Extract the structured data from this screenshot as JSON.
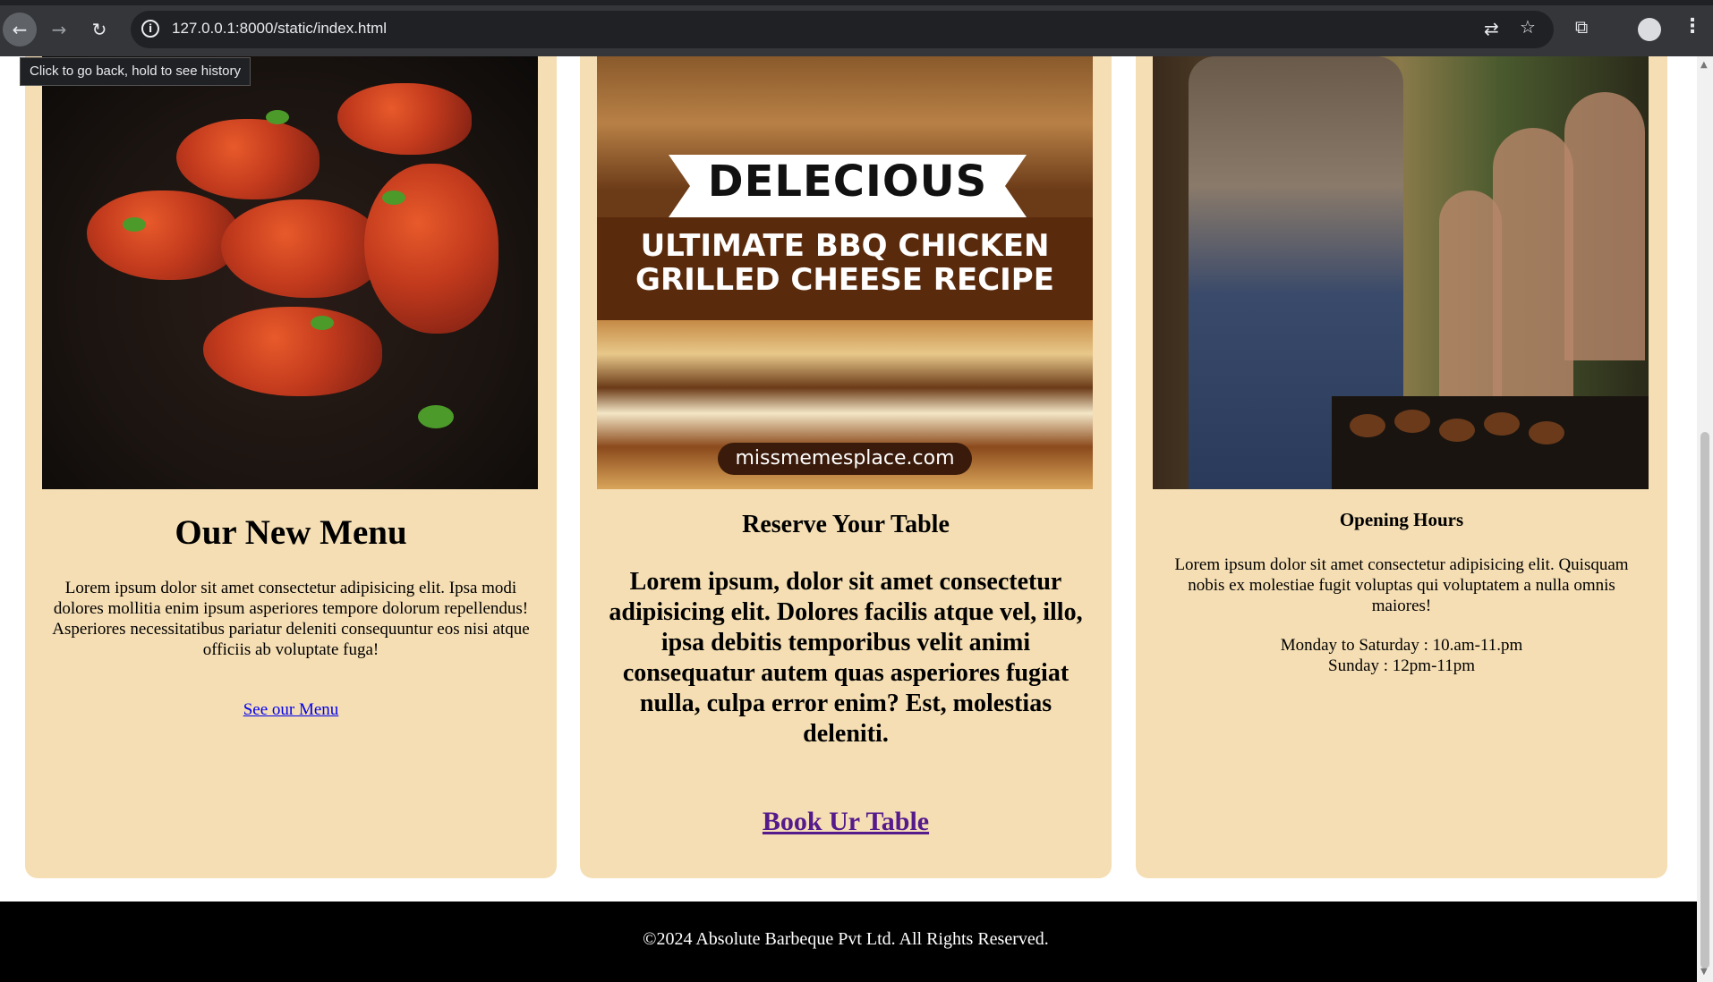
{
  "browser": {
    "url": "127.0.0.1:8000/static/index.html",
    "tooltip": "Click to go back, hold to see history"
  },
  "menu_card": {
    "title": "Our New Menu",
    "text": "Lorem ipsum dolor sit amet consectetur adipisicing elit. Ipsa modi dolores mollitia enim ipsum asperiores tempore dolorum repellendus! Asperiores necessitatibus pariatur deleniti consequuntur eos nisi atque officiis ab voluptate fuga!",
    "link": "See our Menu"
  },
  "reserve_card": {
    "image_banner": "DELECIOUS",
    "image_line1": "ULTIMATE BBQ CHICKEN",
    "image_line2": "GRILLED CHEESE RECIPE",
    "image_site": "missmemesplace.com",
    "title": "Reserve Your Table",
    "text": "Lorem ipsum, dolor sit amet consectetur adipisicing elit. Dolores facilis atque vel, illo, ipsa debitis temporibus velit animi consequatur autem quas asperiores fugiat nulla, culpa error enim? Est, molestias deleniti.",
    "link": "Book Ur Table"
  },
  "hours_card": {
    "title": "Opening Hours",
    "text": "Lorem ipsum dolor sit amet consectetur adipisicing elit. Quisquam nobis ex molestiae fugit voluptas qui voluptatem a nulla omnis maiores!",
    "weekday_hours": "Monday to Saturday : 10.am-11.pm",
    "sunday_hours": "Sunday : 12pm-11pm"
  },
  "footer": {
    "copyright": "©2024 Absolute Barbeque Pvt Ltd. All Rights Reserved."
  },
  "colors": {
    "card_bg": "#f5deb3",
    "footer_bg": "#000000",
    "link": "#0000ee",
    "visited_link": "#551a8b"
  }
}
